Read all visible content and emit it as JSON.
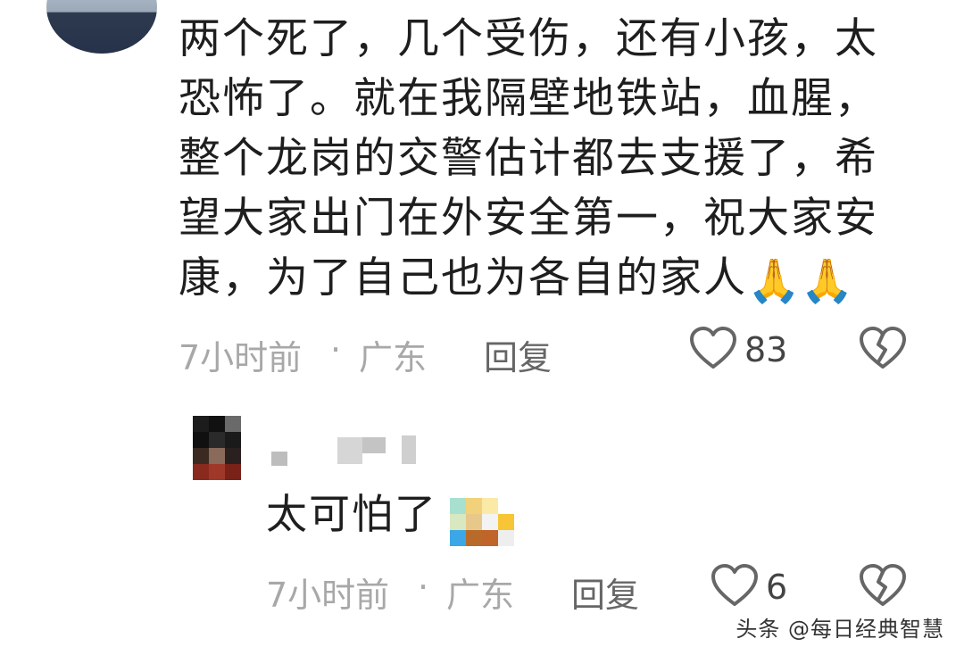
{
  "comment": {
    "text": "两个死了，几个受伤，还有小孩，太恐怖了。就在我隔壁地铁站，血腥，整个龙岗的交警估计都去支援了，希望大家出门在外安全第一，祝大家安康，为了自己也为各自的家人",
    "emoji": "🙏🙏",
    "time": "7小时前",
    "separator": "·",
    "location": "广东",
    "reply_label": "回复",
    "like_count": "83",
    "like_icon": "heart-outline-icon",
    "dislike_icon": "broken-heart-icon"
  },
  "reply": {
    "text": "太可怕了",
    "time": "7小时前",
    "separator": "·",
    "location": "广东",
    "reply_label": "回复",
    "like_count": "6"
  },
  "watermark": "头条 @每日经典智慧",
  "colors": {
    "text": "#1e1e1e",
    "meta": "#a8a8a8",
    "icon": "#666666",
    "emoji": "#f6b52e"
  }
}
